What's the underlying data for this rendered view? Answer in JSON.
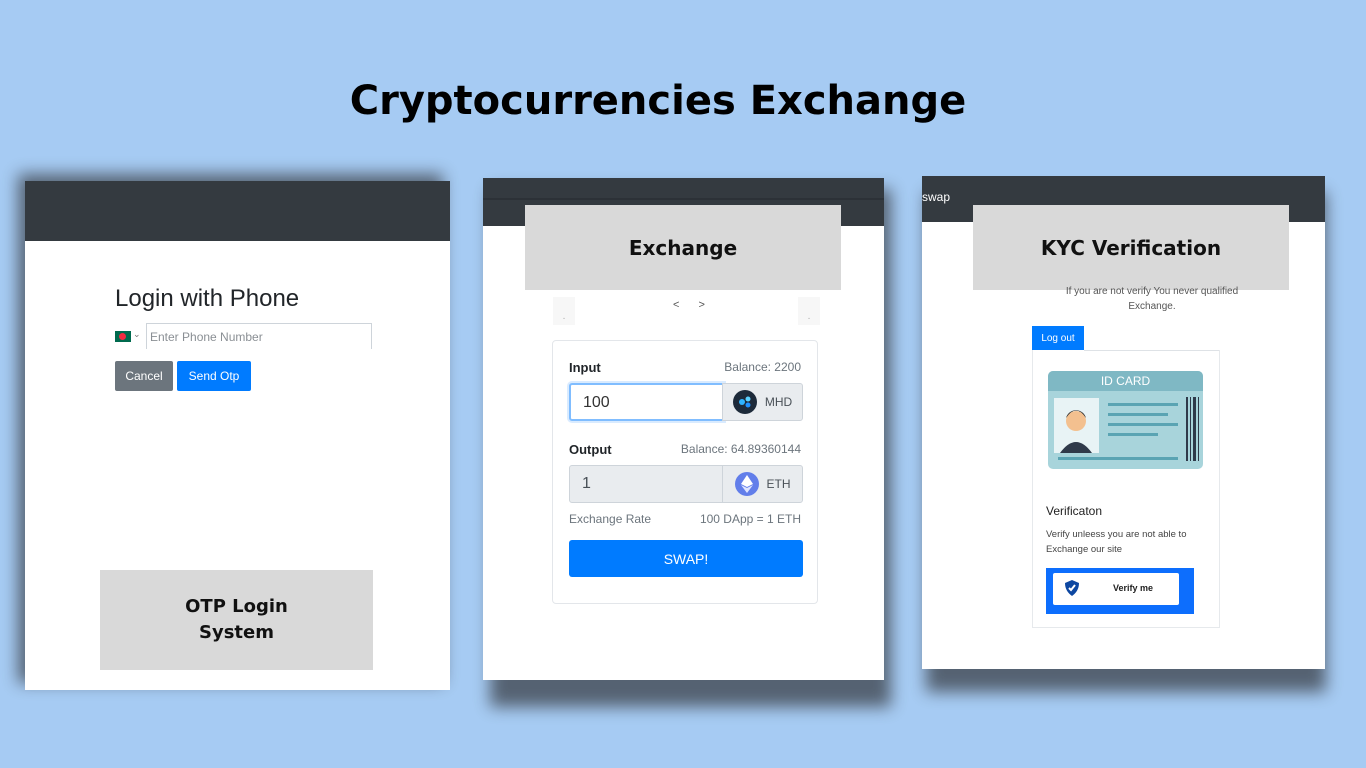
{
  "page": {
    "title": "Cryptocurrencies Exchange"
  },
  "otp_panel": {
    "login_title": "Login with Phone",
    "phone_placeholder": "Enter Phone Number",
    "cancel_label": "Cancel",
    "send_label": "Send Otp",
    "caption": "OTP Login System"
  },
  "exchange_panel": {
    "caption": "Exchange",
    "pager": "< >",
    "nav_prev": ".",
    "nav_next": ".",
    "input_label": "Input",
    "input_balance": "Balance: 2200",
    "input_value": "100",
    "input_token": "MHD",
    "output_label": "Output",
    "output_balance": "Balance: 64.89360144",
    "output_value": "1",
    "output_token": "ETH",
    "rate_label": "Exchange Rate",
    "rate_value": "100 DApp = 1 ETH",
    "swap_label": "SWAP!"
  },
  "kyc_panel": {
    "nav_link": "swap",
    "caption": "KYC Verification",
    "notice": "If you are not verify You never qualified Exchange.",
    "logout_tab": "Log out",
    "id_card_label": "ID CARD",
    "verification_title": "Verificaton",
    "verification_text": "Verify unleess you are not able to Exchange our site",
    "verify_button": "Verify me"
  },
  "colors": {
    "background": "#a6cbf3",
    "navbar": "#343a40",
    "primary": "#007bff",
    "secondary": "#6c757d"
  }
}
